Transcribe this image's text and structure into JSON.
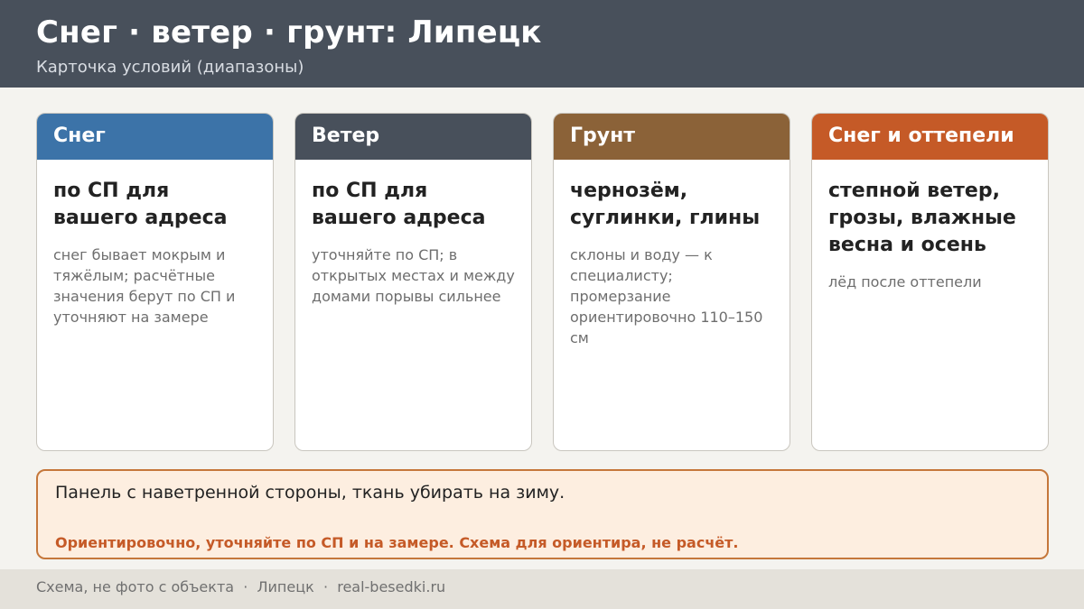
{
  "header": {
    "title": "Снег · ветер · грунт: Липецк",
    "subtitle": "Карточка условий (диапазоны)"
  },
  "cards": [
    {
      "label": "Снег",
      "main": "по СП для вашего адреса",
      "note": "снег бывает мокрым и тяжёлым; расчётные значения берут по СП и уточняют на замере",
      "color": "#3c73a8"
    },
    {
      "label": "Ветер",
      "main": "по СП для вашего адреса",
      "note": "уточняйте по СП; в открытых местах и между домами порывы сильнее",
      "color": "#48505b"
    },
    {
      "label": "Грунт",
      "main": "чернозём, суглинки, глины",
      "note": "склоны и воду — к специалисту; промерзание ориентировочно 110–150 см",
      "color": "#8b6238"
    },
    {
      "label": "Снег и оттепели",
      "main": "степной ветер, грозы, влажные весна и осень",
      "note": "лёд после оттепели",
      "color": "#c55a27"
    }
  ],
  "panel": {
    "text": "Панель с наветренной стороны, ткань убирать на зиму.",
    "warning": "Ориентировочно, уточняйте по СП и на замере. Схема для ориентира, не расчёт."
  },
  "footer": {
    "text": "Схема, не фото с объекта  ·  Липецк  ·  real-besedki.ru"
  }
}
